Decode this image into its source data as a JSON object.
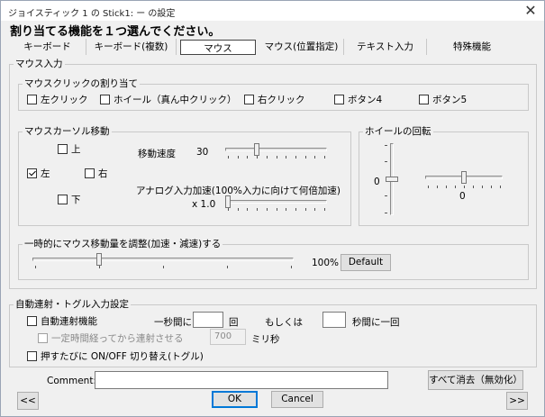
{
  "window": {
    "title": "ジョイスティック 1 の Stick1: ー の設定",
    "close_glyph": "✕"
  },
  "instruction": "割り当てる機能を１つ選んでください。",
  "tabs": [
    {
      "label": "キーボード"
    },
    {
      "label": "キーボード(複数)"
    },
    {
      "label": "マウス",
      "selected": true
    },
    {
      "label": "マウス(位置指定)"
    },
    {
      "label": "テキスト入力"
    },
    {
      "label": "特殊機能"
    }
  ],
  "mouse_input": {
    "title": "マウス入力",
    "click_group": {
      "title": "マウスクリックの割り当て",
      "items": [
        {
          "label": "左クリック",
          "checked": false
        },
        {
          "label": "ホイール（真ん中クリック）",
          "checked": false
        },
        {
          "label": "右クリック",
          "checked": false
        },
        {
          "label": "ボタン4",
          "checked": false
        },
        {
          "label": "ボタン5",
          "checked": false
        }
      ]
    },
    "cursor_group": {
      "title": "マウスカーソル移動",
      "up": {
        "label": "上",
        "checked": false
      },
      "left": {
        "label": "左",
        "checked": true
      },
      "right": {
        "label": "右",
        "checked": false
      },
      "down": {
        "label": "下",
        "checked": false
      },
      "speed_label": "移動速度",
      "speed_value": "30",
      "speed_level": 0.3,
      "analog_label": "アナログ入力加速(100%入力に向けて何倍加速)",
      "analog_value": "x 1.0",
      "analog_level": 0.0
    },
    "wheel_group": {
      "title": "ホイールの回転",
      "vertical_value": "0",
      "horizontal_value": "0"
    },
    "temp_group": {
      "title": "一時的にマウス移動量を調整(加速・減速)する",
      "percent": "100%",
      "level": 0.25,
      "default_button": "Default"
    }
  },
  "auto_fire": {
    "title": "自動連射・トグル入力設定",
    "enable": {
      "label": "自動連射機能",
      "checked": false
    },
    "per_label": "一秒間に",
    "count_value": "",
    "count_unit": "回",
    "or_label": "もしくは",
    "seconds_value": "",
    "seconds_unit": "秒間に一回",
    "delay": {
      "label": "一定時間経ってから連射させる",
      "checked": false,
      "disabled": true
    },
    "delay_value": "700",
    "delay_unit": "ミリ秒",
    "toggle": {
      "label": "押すたびに ON/OFF 切り替え(トグル)",
      "checked": false
    }
  },
  "footer": {
    "comment_label": "Comment:",
    "comment_value": "",
    "clear_all": "すべて消去（無効化）",
    "prev": "<<",
    "ok": "OK",
    "cancel": "Cancel",
    "next": ">>"
  }
}
